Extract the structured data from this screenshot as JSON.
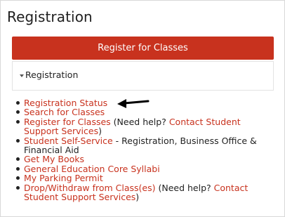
{
  "page": {
    "title": "Registration"
  },
  "register_button": {
    "label": "Register for Classes"
  },
  "accordion": {
    "label": "Registration"
  },
  "links": {
    "registration_status": "Registration Status",
    "search_for_classes": "Search for Classes",
    "register_for_classes": "Register for Classes",
    "register_help_prefix": " (Need help? ",
    "contact_support": "Contact Student Support Services",
    "register_help_suffix": ")",
    "student_self_service": "Student Self-Service",
    "self_service_desc": " - Registration, Business Office & Financial Aid",
    "get_my_books": "Get My Books",
    "gen_ed_syllabi": "General Education Core Syllabi",
    "parking_permit": "My Parking Permit",
    "drop_withdraw": "Drop/Withdraw from Class(es)",
    "drop_help_prefix": " (Need help? ",
    "drop_contact_support": "Contact Student Support Services",
    "drop_help_suffix": ")"
  },
  "colors": {
    "accent": "#c8321e",
    "text": "#222222",
    "border": "#e3e3e3"
  },
  "icons": {
    "pointer_arrow": "left-arrow-icon",
    "accordion_caret": "caret-down-icon"
  }
}
